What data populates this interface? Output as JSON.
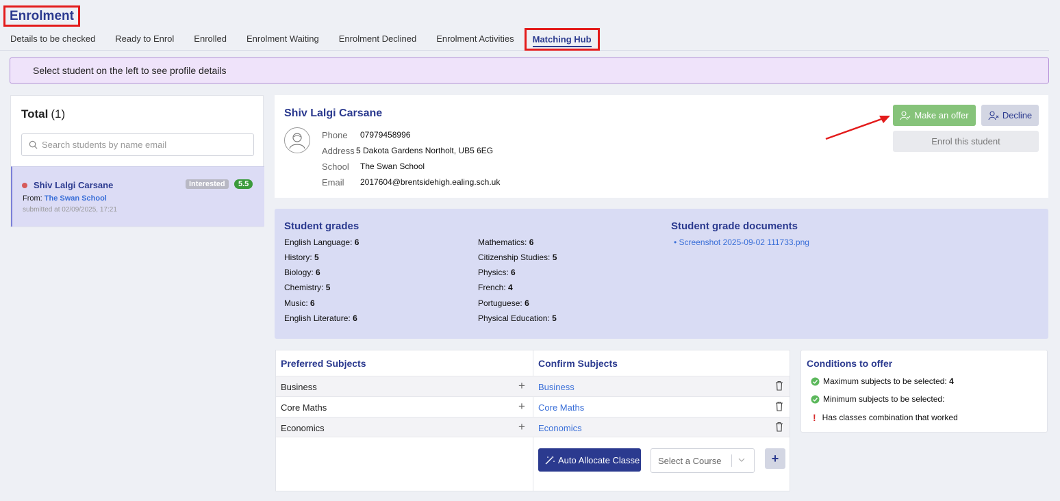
{
  "page": {
    "title": "Enrolment"
  },
  "tabs": [
    {
      "label": "Details to be checked"
    },
    {
      "label": "Ready to Enrol"
    },
    {
      "label": "Enrolled"
    },
    {
      "label": "Enrolment Waiting"
    },
    {
      "label": "Enrolment Declined"
    },
    {
      "label": "Enrolment Activities"
    },
    {
      "label": "Matching Hub",
      "active": true
    }
  ],
  "banner": {
    "text": "Select student on the left to see profile details"
  },
  "sidebar": {
    "total_label": "Total",
    "total_count": "(1)",
    "search_placeholder": "Search students by name email",
    "student": {
      "name": "Shiv Lalgi Carsane",
      "status": "Interested",
      "score": "5.5",
      "from_label": "From:",
      "from_school": "The Swan School",
      "submitted": "submitted at 02/09/2025, 17:21",
      "status_color": "#d65a5a"
    }
  },
  "profile": {
    "name": "Shiv Lalgi Carsane",
    "phone_label": "Phone",
    "phone": "07979458996",
    "address_label": "Address",
    "address": "5 Dakota Gardens Northolt, UB5 6EG",
    "school_label": "School",
    "school": "The Swan School",
    "email_label": "Email",
    "email": "2017604@brentsidehigh.ealing.sch.uk",
    "make_offer": "Make an offer",
    "decline": "Decline",
    "enrol": "Enrol this student"
  },
  "grades": {
    "title": "Student grades",
    "docs_title": "Student grade documents",
    "left": [
      {
        "subject": "English Language:",
        "grade": "6"
      },
      {
        "subject": "History:",
        "grade": "5"
      },
      {
        "subject": "Biology:",
        "grade": "6"
      },
      {
        "subject": "Chemistry:",
        "grade": "5"
      },
      {
        "subject": "Music:",
        "grade": "6"
      },
      {
        "subject": "English Literature:",
        "grade": "6"
      }
    ],
    "right": [
      {
        "subject": "Mathematics:",
        "grade": "6"
      },
      {
        "subject": "Citizenship Studies:",
        "grade": "5"
      },
      {
        "subject": "Physics:",
        "grade": "6"
      },
      {
        "subject": "French:",
        "grade": "4"
      },
      {
        "subject": "Portuguese:",
        "grade": "6"
      },
      {
        "subject": "Physical Education:",
        "grade": "5"
      }
    ],
    "documents": [
      "Screenshot 2025-09-02 111733.png"
    ]
  },
  "subjects": {
    "preferred_title": "Preferred Subjects",
    "confirm_title": "Confirm Subjects",
    "preferred": [
      "Business",
      "Core Maths",
      "Economics"
    ],
    "confirmed": [
      "Business",
      "Core Maths",
      "Economics"
    ],
    "auto_allocate": "Auto Allocate Classe",
    "select_course_placeholder": "Select a Course",
    "add": "+"
  },
  "conditions": {
    "title": "Conditions to offer",
    "items": [
      {
        "label": "Maximum subjects to be selected:",
        "value": "4",
        "status": "ok"
      },
      {
        "label": "Minimum subjects to be selected:",
        "value": "",
        "status": "ok"
      },
      {
        "label": "Has classes combination that worked",
        "value": "",
        "status": "warn"
      }
    ]
  },
  "colors": {
    "primary": "#2b3a8f",
    "offer": "#86c37a",
    "highlight": "#e31b1b",
    "success": "#3c9b3c"
  }
}
